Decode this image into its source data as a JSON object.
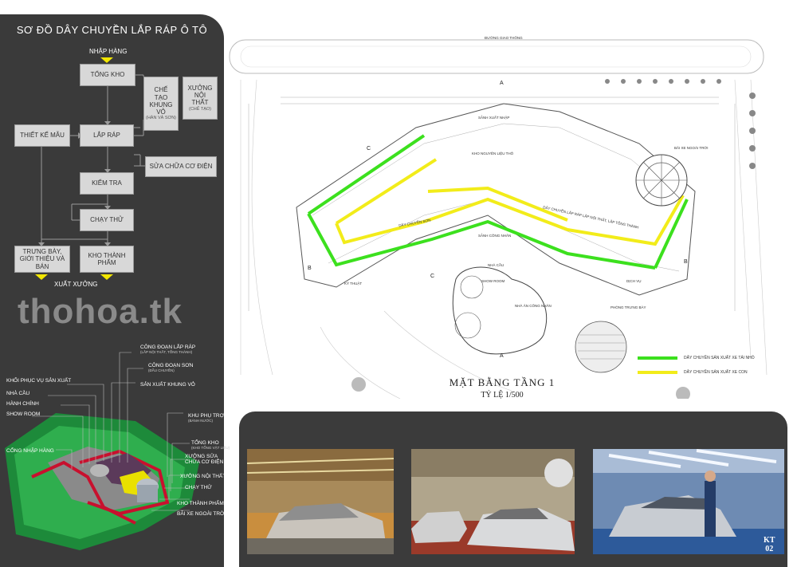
{
  "flowchart": {
    "title": "SƠ ĐỒ DÂY CHUYỀN LẮP RÁP Ô TÔ",
    "nhap_hang": "NHẬP HÀNG",
    "tong_kho": "TỔNG KHO",
    "che_tao": "CHẾ TẠO KHUNG VỎ",
    "che_tao_sub": "(HÀN VÀ SƠN)",
    "xuong_noi_that": "XƯỞNG NỘI THẤT",
    "xuong_noi_that_sub": "(CHẾ TẠO)",
    "thiet_ke_mau": "THIẾT KẾ MẪU",
    "lap_rap": "LẮP RÁP",
    "sua_chua": "SỬA CHỮA CƠ ĐIỆN",
    "kiem_tra": "KIỂM TRA",
    "chay_thu": "CHẠY THỬ",
    "trung_bay": "TRƯNG BÀY, GIỚI THIỆU VÀ BÁN",
    "kho_thanh_pham": "KHO THÀNH PHẨM",
    "xuat_xuong": "XUẤT XƯỞNG"
  },
  "watermark": "thohoa.tk",
  "axonometric": {
    "labels": [
      {
        "text": "CÔNG ĐOẠN LẮP RÁP",
        "sub": "(LẮP NỘI THẤT, TỔNG THÀNH)"
      },
      {
        "text": "CÔNG ĐOẠN SƠN",
        "sub": "(ĐẦU CHUYỀN)"
      },
      {
        "text": "KHỐI PHỤC VỤ SẢN XUẤT",
        "sub": ""
      },
      {
        "text": "SẢN XUẤT KHUNG VỎ",
        "sub": ""
      },
      {
        "text": "NHÀ CẦU",
        "sub": ""
      },
      {
        "text": "HÀNH CHÍNH",
        "sub": ""
      },
      {
        "text": "SHOW ROOM",
        "sub": ""
      },
      {
        "text": "KHU PHỤ TRỢ",
        "sub": "(BÁNH NƯỚC)"
      },
      {
        "text": "CỔNG NHẬP HÀNG",
        "sub": ""
      },
      {
        "text": "TỔNG KHO",
        "sub": "(KHO TỔNG VẬT LIỆU)"
      },
      {
        "text": "XƯỞNG SỬA CHỮA CƠ ĐIỆN",
        "sub": ""
      },
      {
        "text": "XƯỞNG NỘI THẤT",
        "sub": ""
      },
      {
        "text": "CHẠY THỬ",
        "sub": ""
      },
      {
        "text": "KHO THÀNH PHẨM",
        "sub": ""
      },
      {
        "text": "BÃI XE NGOÀI TRỜI",
        "sub": ""
      }
    ]
  },
  "plan": {
    "title": "MẶT BẰNG TẦNG 1",
    "scale": "TỶ LỆ 1/500",
    "road": "ĐƯỜNG GIAO THÔNG",
    "labels": {
      "sanh_xuat_nhap": "SẢNH XUẤT NHẬP",
      "kho_nguyen_lieu": "KHO NGUYÊN LIỆU THÔ",
      "day_chuyen_son": "DÂY CHUYỀN SƠN",
      "day_chuyen_lap_rap": "DÂY CHUYỀN LẮP RÁP LẮP NỘI THẤT, LẮP TỔNG THÀNH",
      "sanh_cong_nhan": "SẢNH CÔNG NHÂN",
      "nha_an": "NHÀ ĂN CÔNG NHÂN",
      "showroom": "SHOW ROOM",
      "phong_trung_bay": "PHÒNG TRƯNG BÀY",
      "bai_xe": "BÃI XE NGOÀI TRỜI",
      "dich_vu": "DỊCH VỤ",
      "ky_thuat": "KỸ THUẬT",
      "nha_cau": "NHÀ CẦU"
    },
    "legend": [
      {
        "color": "#3ce01e",
        "text": "DÂY CHUYỀN SẢN XUẤT XE TẢI NHỎ"
      },
      {
        "color": "#f2ec1a",
        "text": "DÂY CHUYỀN SẢN XUẤT XE CON"
      }
    ]
  },
  "sheet": {
    "code_1": "KT",
    "code_2": "02"
  },
  "colors": {
    "panel": "#3a3a3a",
    "green": "#3ce01e",
    "yellow": "#f2ec1a",
    "red": "#c8102e"
  }
}
